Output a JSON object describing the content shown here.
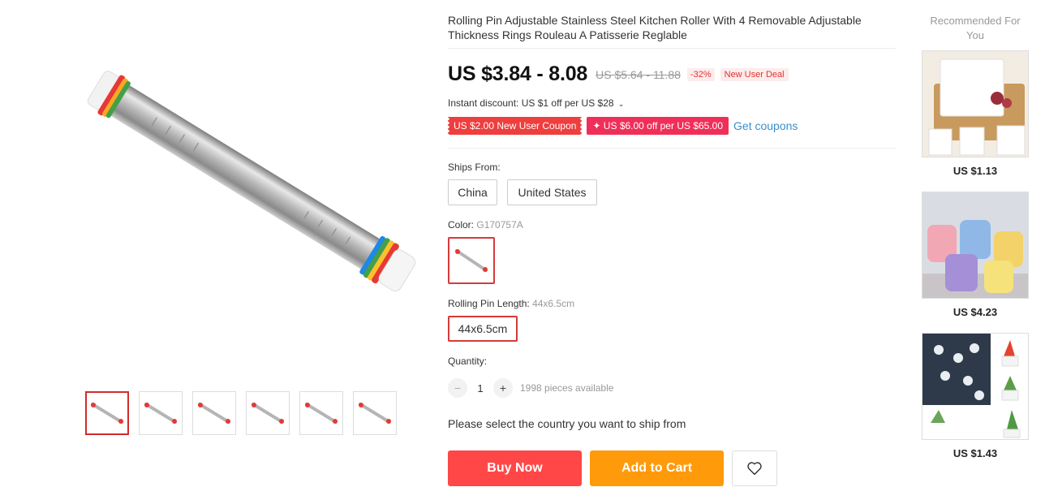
{
  "product": {
    "title": "Rolling Pin Adjustable Stainless Steel Kitchen Roller With 4 Removable Adjustable Thickness Rings Rouleau A Patisserie Reglable",
    "price": "US $3.84 - 8.08",
    "original_price": "US $5.64 - 11.88",
    "discount": "-32%",
    "deal_badge": "New User Deal",
    "instant_discount": "Instant discount: US $1 off per US $28",
    "coupon_new_user": "US $2.00 New User Coupon",
    "coupon_store": "✦ US $6.00 off per US $65.00",
    "get_coupons": "Get coupons",
    "thumbnail_count": 6
  },
  "ships_from": {
    "label": "Ships From:",
    "options": [
      "China",
      "United States"
    ]
  },
  "color": {
    "label": "Color:",
    "value": "G170757A"
  },
  "length": {
    "label": "Rolling Pin Length:",
    "value": "44x6.5cm",
    "options": [
      "44x6.5cm"
    ]
  },
  "quantity": {
    "label": "Quantity:",
    "value": "1",
    "minus": "−",
    "plus": "+",
    "available": "1998 pieces available"
  },
  "ship_message": "Please select the country you want to ship from",
  "actions": {
    "buy_now": "Buy Now",
    "add_to_cart": "Add to Cart",
    "wishlist_icon": "heart-icon"
  },
  "recommended": {
    "title": "Recommended For You",
    "items": [
      {
        "price": "US $1.13",
        "image": "tea-filter-bags"
      },
      {
        "price": "US $4.23",
        "image": "cat-ceramic-mugs"
      },
      {
        "price": "US $1.43",
        "image": "succulent-magnet-pots"
      }
    ]
  },
  "colors": {
    "accent_red": "#ff4747",
    "accent_orange": "#ff9a0a",
    "link_blue": "#3a8fc9",
    "selected_border": "#d63a3a"
  }
}
